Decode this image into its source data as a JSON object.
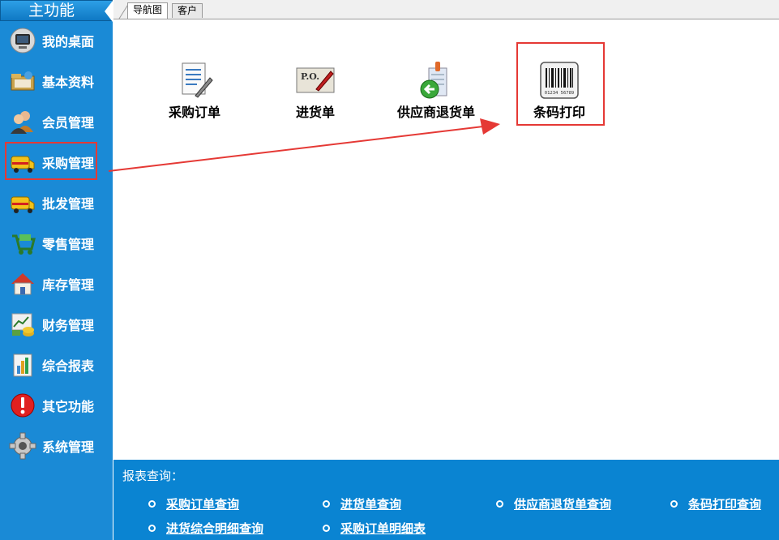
{
  "sidebar": {
    "title": "主功能",
    "items": [
      {
        "label": "我的桌面",
        "icon": "desktop-monitor-icon"
      },
      {
        "label": "基本资料",
        "icon": "folder-icon"
      },
      {
        "label": "会员管理",
        "icon": "members-icon"
      },
      {
        "label": "采购管理",
        "icon": "delivery-truck-icon",
        "active": true
      },
      {
        "label": "批发管理",
        "icon": "delivery-truck-icon"
      },
      {
        "label": "零售管理",
        "icon": "shopping-cart-icon"
      },
      {
        "label": "库存管理",
        "icon": "house-icon"
      },
      {
        "label": "财务管理",
        "icon": "finance-chart-icon"
      },
      {
        "label": "综合报表",
        "icon": "bar-chart-icon"
      },
      {
        "label": "其它功能",
        "icon": "exclamation-icon"
      },
      {
        "label": "系统管理",
        "icon": "gear-icon"
      }
    ]
  },
  "tabs": [
    {
      "label": "导航图",
      "selected": true
    },
    {
      "label": "客户",
      "selected": false
    }
  ],
  "main": {
    "tiles": [
      {
        "label": "采购订单",
        "icon": "document-pen-icon"
      },
      {
        "label": "进货单",
        "icon": "purchase-order-icon",
        "icon_text": "P.O."
      },
      {
        "label": "供应商退货单",
        "icon": "return-goods-icon"
      },
      {
        "label": "条码打印",
        "icon": "barcode-icon",
        "icon_text": "01234 56789",
        "highlighted": true
      }
    ]
  },
  "reports": {
    "title": "报表查询：",
    "links": [
      "采购订单查询",
      "进货单查询",
      "供应商退货单查询",
      "条码打印查询",
      "进货综合明细查询",
      "采购订单明细表"
    ]
  },
  "colors": {
    "sidebar_bg": "#1a8ad6",
    "reports_bg": "#0a84d2",
    "highlight": "#e53935"
  }
}
